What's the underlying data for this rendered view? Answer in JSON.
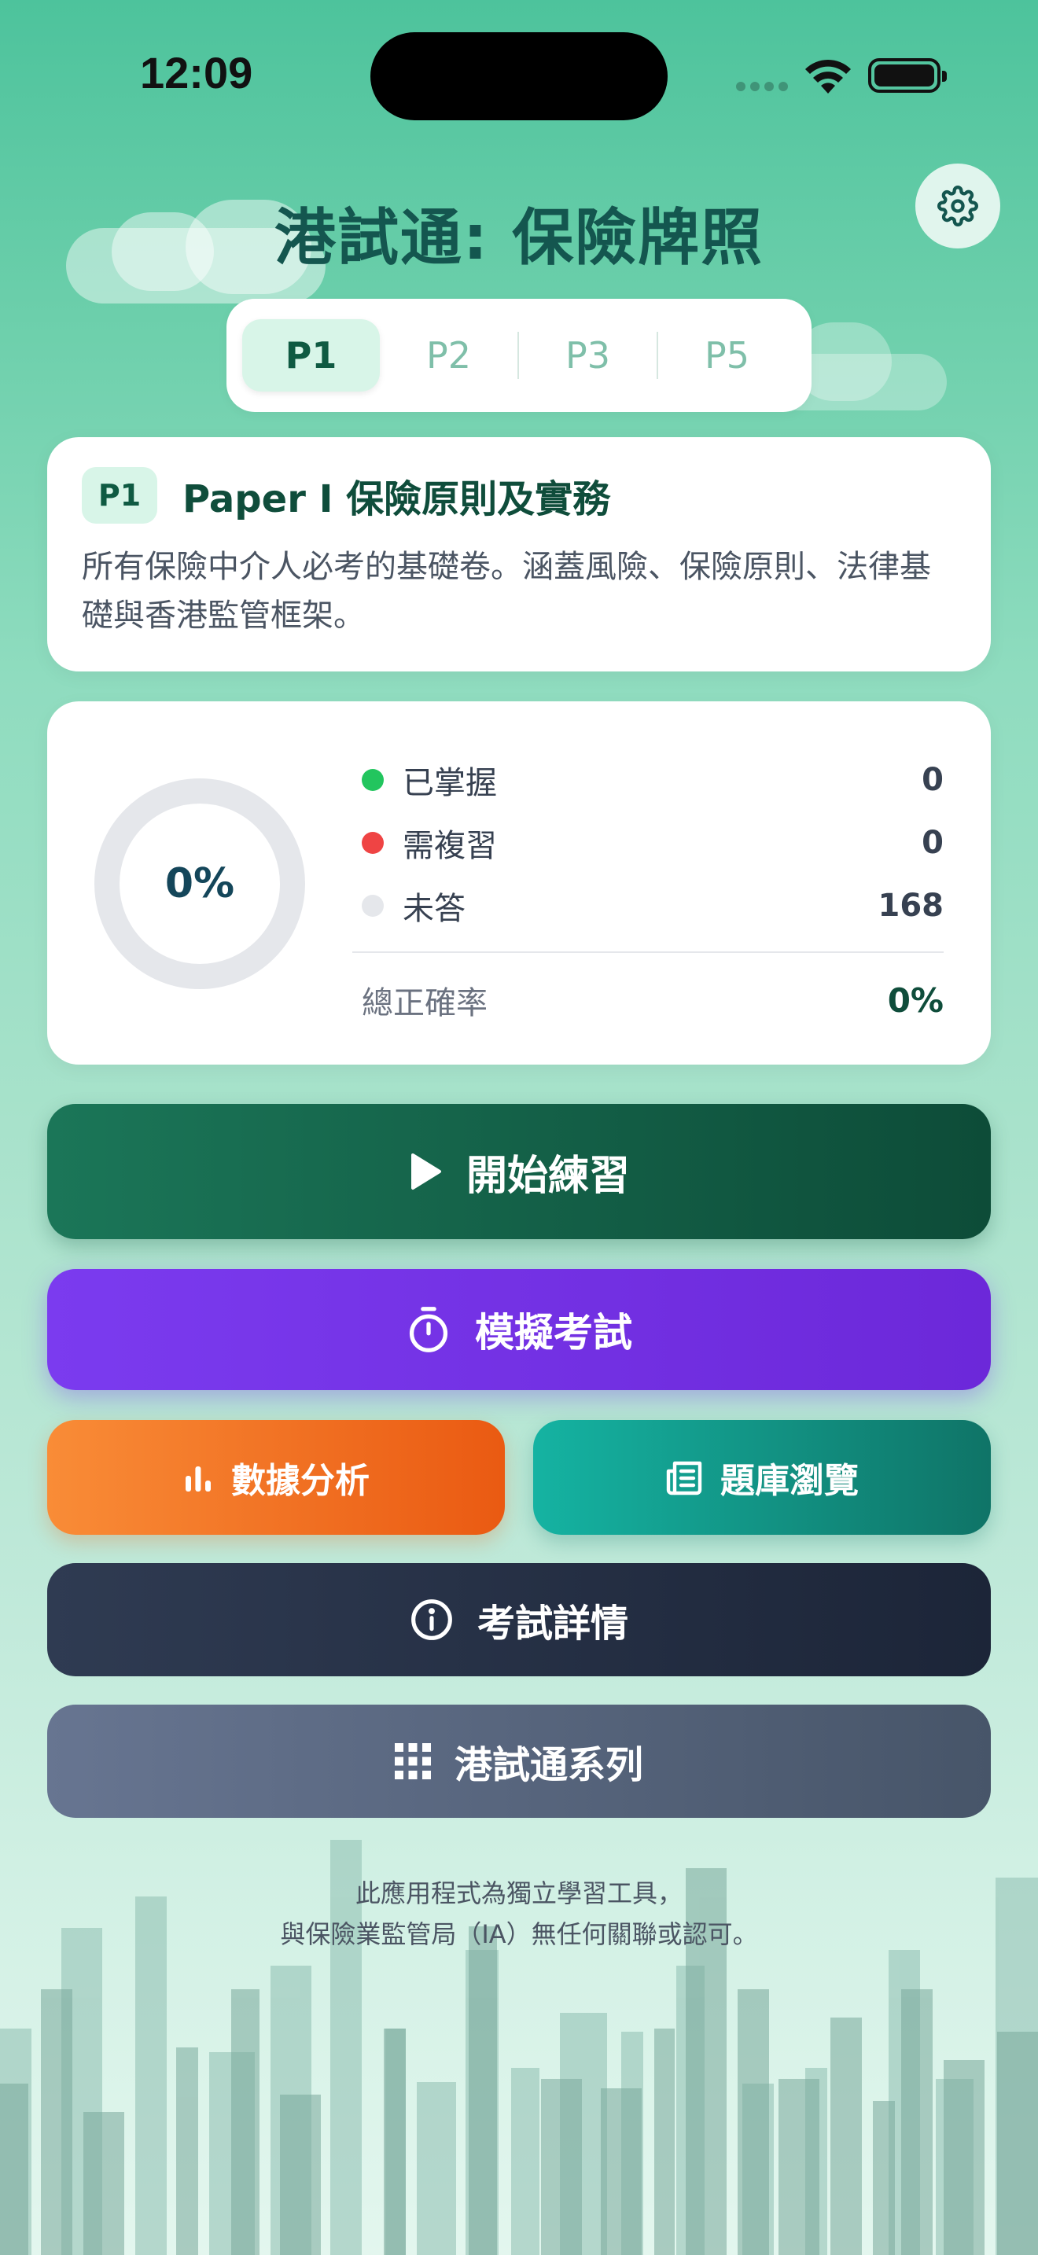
{
  "status_bar": {
    "time": "12:09"
  },
  "app": {
    "title": "港試通: 保險牌照"
  },
  "paper_tabs": [
    "P1",
    "P2",
    "P3",
    "P5"
  ],
  "paper_info": {
    "badge": "P1",
    "title": "Paper I 保險原則及實務",
    "description": "所有保險中介人必考的基礎卷。涵蓋風險、保險原則、法律基礎與香港監管框架。"
  },
  "progress": {
    "percent_label": "0%",
    "mastered": {
      "label": "已掌握",
      "value": "0",
      "color": "#22c55e"
    },
    "review": {
      "label": "需複習",
      "value": "0",
      "color": "#ef4444"
    },
    "unanswered": {
      "label": "未答",
      "value": "168",
      "color": "#e5e7eb"
    },
    "accuracy": {
      "label": "總正確率",
      "value": "0%"
    }
  },
  "actions": {
    "start": "開始練習",
    "mock_exam": "模擬考試",
    "analytics": "數據分析",
    "question_bank": "題庫瀏覽",
    "exam_details": "考試詳情",
    "series": "港試通系列"
  },
  "disclaimer": {
    "line1": "此應用程式為獨立學習工具，",
    "line2": "與保險業監管局（IA）無任何關聯或認可。"
  },
  "icons": {
    "settings": "gear-icon",
    "start": "play-icon",
    "mock_exam": "stopwatch-icon",
    "analytics": "bar-chart-icon",
    "question_bank": "newspaper-icon",
    "exam_details": "info-icon",
    "series": "grid-icon"
  }
}
